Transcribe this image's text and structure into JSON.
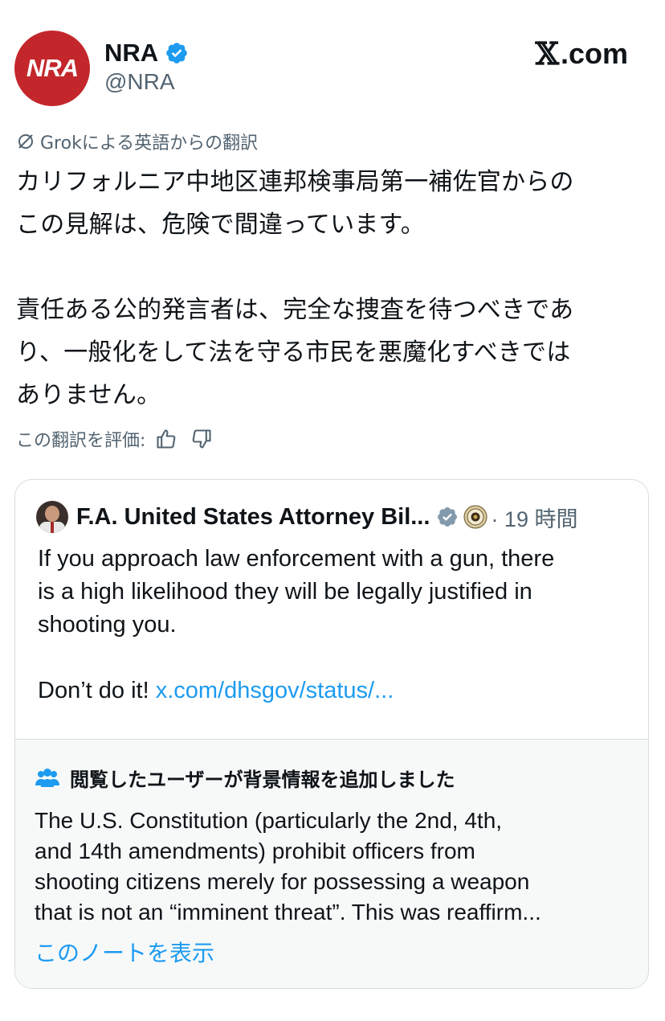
{
  "author": {
    "avatar_text": "NRA",
    "display_name": "NRA",
    "handle": "@NRA",
    "verified": true
  },
  "brand": {
    "x_glyph": "𝕏",
    "text": ".com"
  },
  "translation": {
    "note": "Grokによる英語からの翻訳",
    "icon": "grok-icon"
  },
  "post": {
    "body": "カリフォルニア中地区連邦検事局第一補佐官からの\nこの見解は、危険で間違っています。\n\n責任ある公的発言者は、完全な捜査を待つべきであ\nり、一般化をして法を守る市民を悪魔化すべきでは\nありません。"
  },
  "rate": {
    "label": "この翻訳を評価:",
    "up_icon": "thumbs-up-icon",
    "down_icon": "thumbs-down-icon"
  },
  "quote": {
    "display_name": "F.A. United States Attorney Bil...",
    "verified": true,
    "affiliation_icon": "doj-seal-icon",
    "time": "· 19 時間",
    "text": "If you approach law enforcement with a gun, there\nis a high likelihood they will be legally justified in\nshooting you.\n\nDon’t do it! ",
    "link": "x.com/dhsgov/status/..."
  },
  "community_note": {
    "title": "閲覧したユーザーが背景情報を追加しました",
    "text": "The U.S. Constitution (particularly the 2nd, 4th,\nand 14th amendments) prohibit officers from\nshooting citizens merely for possessing a weapon\nthat is not an “imminent threat”. This was reaffirm...",
    "show_label": "このノートを表示"
  },
  "colors": {
    "nra_red": "#c3272b",
    "verified_blue": "#1d9bf0",
    "gov_gray": "#829aab",
    "link_blue": "#1d9bf0",
    "secondary_text": "#536471"
  }
}
